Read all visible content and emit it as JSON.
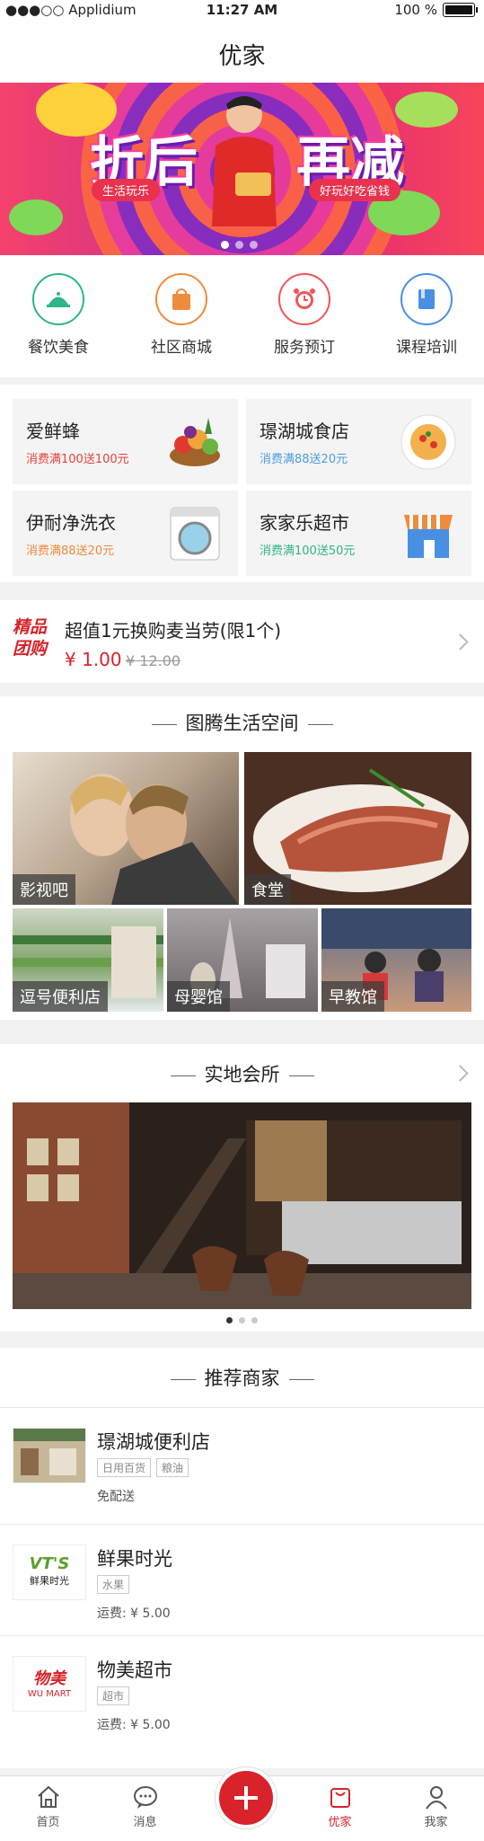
{
  "status": {
    "carrier": "●●●○○ Applidium",
    "time": "11:27 AM",
    "battery": "100 %"
  },
  "nav": {
    "title": "优家"
  },
  "banner": {
    "left_text": "折后",
    "right_text": "再减",
    "tag_left": "生活玩乐",
    "tag_right": "好玩好吃省钱",
    "page_count": 3,
    "active_page": 1
  },
  "quick": [
    {
      "label": "餐饮美食",
      "icon": "food-cloche-icon",
      "color": "#2fb58a"
    },
    {
      "label": "社区商城",
      "icon": "shopping-bag-icon",
      "color": "#f08a3c"
    },
    {
      "label": "服务预订",
      "icon": "alarm-clock-icon",
      "color": "#f0555a"
    },
    {
      "label": "课程培训",
      "icon": "book-icon",
      "color": "#4a90e2"
    }
  ],
  "merchants": [
    {
      "name": "爱鲜蜂",
      "promo": "消费满100送100元",
      "promo_color": "#e8423a",
      "icon": "fruit-basket-icon"
    },
    {
      "name": "璟湖城食店",
      "promo": "消费满88送20元",
      "promo_color": "#4a9ee0",
      "icon": "pasta-plate-icon"
    },
    {
      "name": "伊耐净洗衣",
      "promo": "消费满88送20元",
      "promo_color": "#f08a3c",
      "icon": "washing-machine-icon"
    },
    {
      "name": "家家乐超市",
      "promo": "消费满100送50元",
      "promo_color": "#2fb58a",
      "icon": "store-icon"
    }
  ],
  "group": {
    "logo_line1": "精品",
    "logo_line2": "团购",
    "title": "超值1元换购麦当劳(限1个)",
    "price": "¥ 1.00",
    "old_price": "¥ 12.00"
  },
  "life": {
    "title": "图腾生活空间",
    "tiles": [
      "影视吧",
      "食堂",
      "逗号便利店",
      "母婴馆",
      "早教馆"
    ]
  },
  "club": {
    "title": "实地会所",
    "page_count": 3,
    "active_page": 1
  },
  "rec": {
    "title": "推荐商家",
    "items": [
      {
        "name": "璟湖城便利店",
        "tags": [
          "日用百货",
          "粮油"
        ],
        "extra": "免配送",
        "logo": "storefront-photo"
      },
      {
        "name": "鲜果时光",
        "tags": [
          "水果"
        ],
        "extra": "运费: ¥ 5.00",
        "logo_text": "VT'S",
        "logo_sub": "鲜果时光"
      },
      {
        "name": "物美超市",
        "tags": [
          "超市"
        ],
        "extra": "运费: ¥ 5.00",
        "logo_text": "物美",
        "logo_sub": "WU MART"
      }
    ]
  },
  "tabs": [
    {
      "label": "首页",
      "icon": "home-icon"
    },
    {
      "label": "消息",
      "icon": "message-icon"
    },
    {
      "label": "",
      "icon": "plus-icon"
    },
    {
      "label": "优家",
      "icon": "bag-icon",
      "active": true
    },
    {
      "label": "我家",
      "icon": "user-icon"
    }
  ],
  "colors": {
    "brand_red": "#d8232a"
  }
}
